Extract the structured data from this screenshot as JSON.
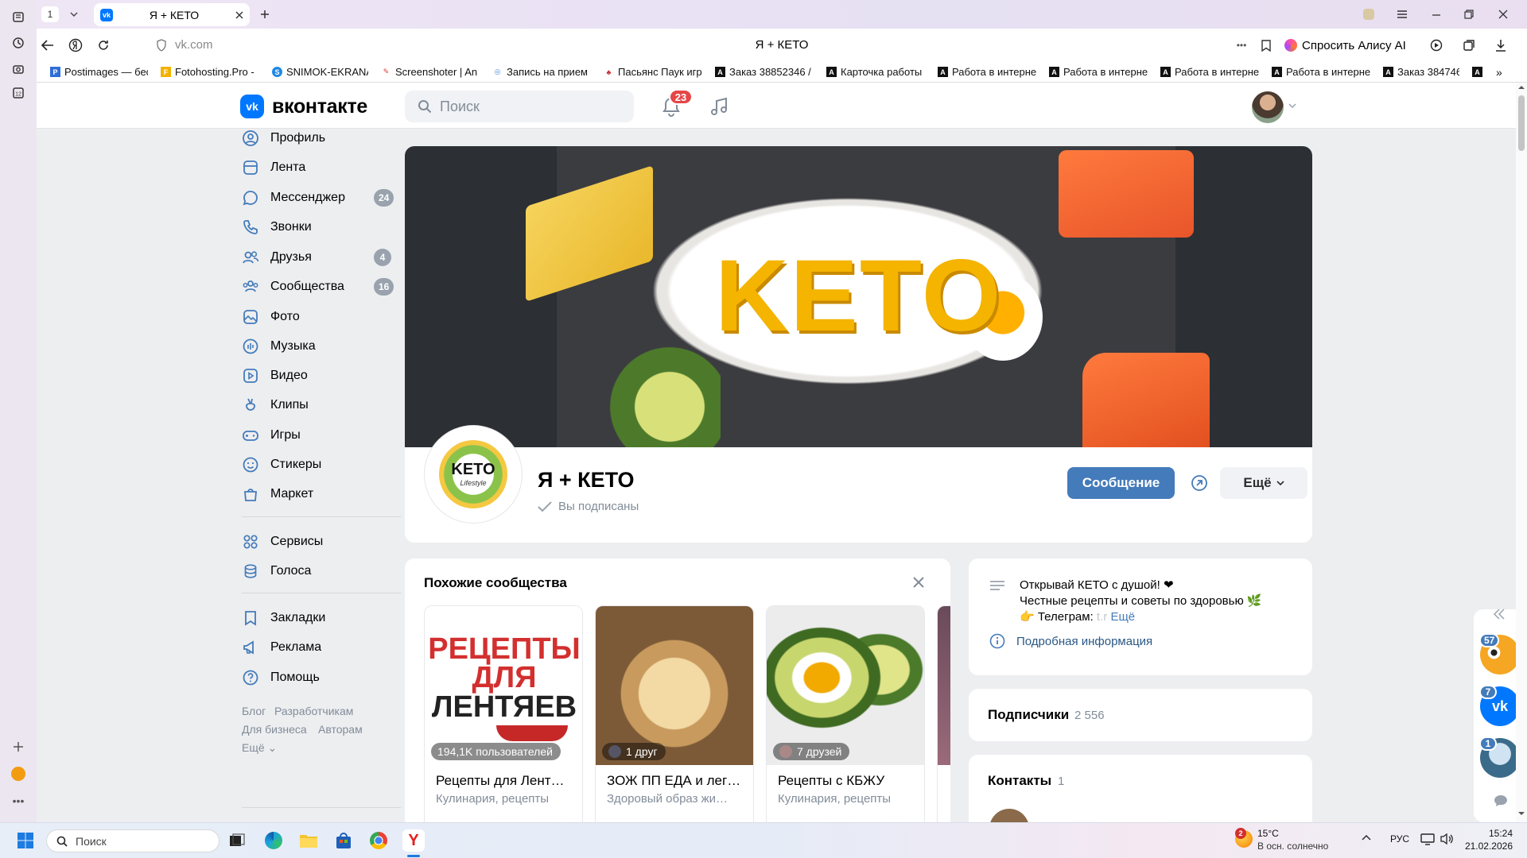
{
  "browser": {
    "tab_count": "1",
    "active_tab_title": "Я + КЕТО",
    "url": "vk.com",
    "page_title": "Я + КЕТО",
    "alice_label": "Спросить Алису AI",
    "bookmarks": [
      {
        "label": "Postimages — бес",
        "color": "#2f6ed6",
        "glyph": "P"
      },
      {
        "label": "Fotohosting.Pro -",
        "color": "#f3b200",
        "glyph": "F"
      },
      {
        "label": "SNIMOK-EKRANA",
        "color": "#1e88e5",
        "glyph": "S"
      },
      {
        "label": "Screenshoter | An",
        "color": "#e53935",
        "glyph": "✎"
      },
      {
        "label": "Запись на прием",
        "color": "#3f8ed8",
        "glyph": "◎"
      },
      {
        "label": "Пасьянс Паук игр",
        "color": "#c62828",
        "glyph": "♣"
      },
      {
        "label": "Заказ 38852346 /",
        "color": "#111111",
        "glyph": "A"
      },
      {
        "label": "Карточка работы",
        "color": "#111111",
        "glyph": "A"
      },
      {
        "label": "Работа в интерне",
        "color": "#111111",
        "glyph": "A"
      },
      {
        "label": "Работа в интерне",
        "color": "#111111",
        "glyph": "A"
      },
      {
        "label": "Работа в интерне",
        "color": "#111111",
        "glyph": "A"
      },
      {
        "label": "Работа в интерне",
        "color": "#111111",
        "glyph": "A"
      },
      {
        "label": "Заказ 384746",
        "color": "#111111",
        "glyph": "A"
      }
    ]
  },
  "vk": {
    "logo_text": "вконтакте",
    "search_placeholder": "Поиск",
    "notifications_count": "23",
    "menu": [
      {
        "label": "Профиль",
        "icon": "user-icon",
        "count": ""
      },
      {
        "label": "Лента",
        "icon": "feed-icon",
        "count": ""
      },
      {
        "label": "Мессенджер",
        "icon": "chat-icon",
        "count": "24"
      },
      {
        "label": "Звонки",
        "icon": "phone-icon",
        "count": ""
      },
      {
        "label": "Друзья",
        "icon": "friends-icon",
        "count": "4"
      },
      {
        "label": "Сообщества",
        "icon": "communities-icon",
        "count": "16"
      },
      {
        "label": "Фото",
        "icon": "photo-icon",
        "count": ""
      },
      {
        "label": "Музыка",
        "icon": "music-icon",
        "count": ""
      },
      {
        "label": "Видео",
        "icon": "video-icon",
        "count": ""
      },
      {
        "label": "Клипы",
        "icon": "clips-icon",
        "count": ""
      },
      {
        "label": "Игры",
        "icon": "games-icon",
        "count": ""
      },
      {
        "label": "Стикеры",
        "icon": "stickers-icon",
        "count": ""
      },
      {
        "label": "Маркет",
        "icon": "market-icon",
        "count": ""
      }
    ],
    "menu2": [
      {
        "label": "Сервисы",
        "icon": "services-icon"
      },
      {
        "label": "Голоса",
        "icon": "coins-icon"
      }
    ],
    "menu3": [
      {
        "label": "Закладки",
        "icon": "bookmark-icon"
      },
      {
        "label": "Реклама",
        "icon": "megaphone-icon"
      },
      {
        "label": "Помощь",
        "icon": "help-icon"
      }
    ],
    "footer": {
      "blog": "Блог",
      "dev": "Разработчикам",
      "business": "Для бизнеса",
      "authors": "Авторам",
      "more": "Ещё"
    }
  },
  "group": {
    "cover_word": "KETO",
    "avatar_text": "KETO",
    "avatar_sub": "Lifestyle",
    "name": "Я + КЕТО",
    "subscribed_label": "Вы подписаны",
    "message_button": "Сообщение",
    "more_button": "Ещё"
  },
  "similar": {
    "title": "Похожие сообщества",
    "items": [
      {
        "name": "Рецепты для Лент…",
        "category": "Кулинария, рецепты",
        "badge": "194,1K пользователей",
        "img_title_1": "РЕЦЕПТЫ",
        "img_title_2": "ДЛЯ",
        "img_title_3": "ЛЕНТЯЕВ"
      },
      {
        "name": "ЗОЖ ПП ЕДА и лег…",
        "category": "Здоровый образ жи…",
        "badge": "1 друг"
      },
      {
        "name": "Рецепты с КБЖУ",
        "category": "Кулинария, рецепты",
        "badge": "7 друзей"
      }
    ]
  },
  "about": {
    "line1": "Открывай КЕТО с душой! ❤",
    "line2": "Честные рецепты и советы по здоровью 🌿",
    "line3_prefix": "👉 Телеграм: ",
    "line3_fade": "t.r",
    "more": "Ещё",
    "details_link": "Подробная информация"
  },
  "subscribers": {
    "label": "Подписчики",
    "count": "2 556"
  },
  "contacts": {
    "label": "Контакты",
    "count": "1"
  },
  "float_panel": [
    {
      "badge": "57"
    },
    {
      "badge": "7"
    },
    {
      "badge": "1"
    }
  ],
  "taskbar": {
    "search_placeholder": "Поиск",
    "weather_temp": "15°C",
    "weather_desc": "В осн. солнечно",
    "weather_badge": "2",
    "lang": "РУС",
    "time": "15:24",
    "date": "21.02.2026"
  }
}
